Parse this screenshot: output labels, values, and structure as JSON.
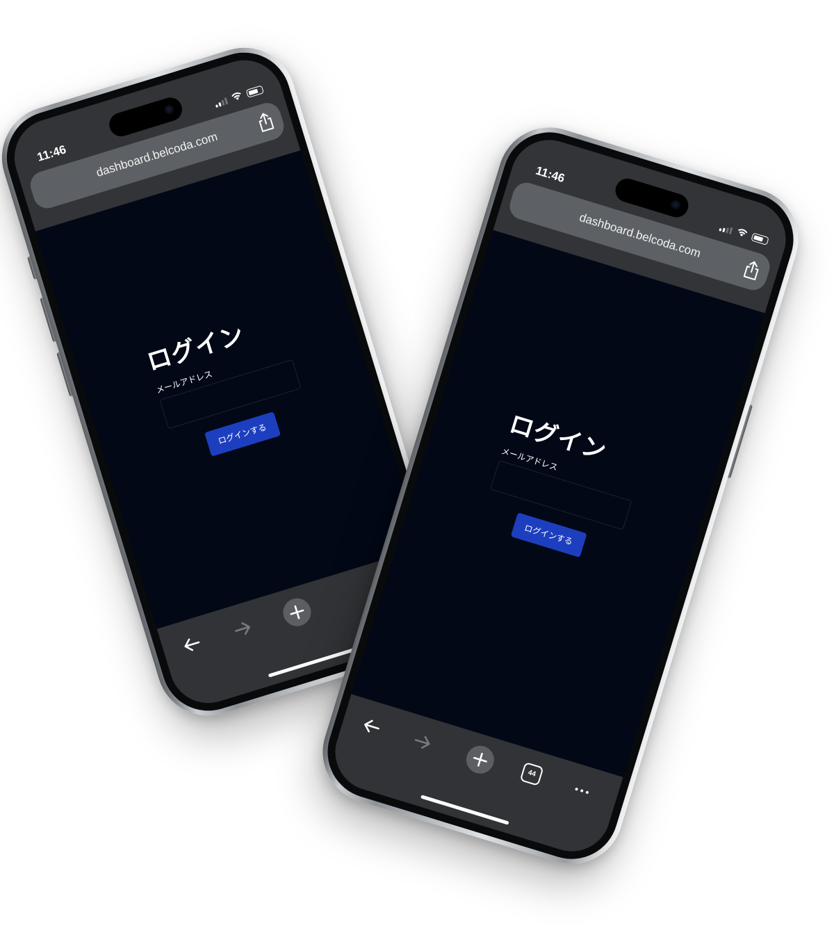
{
  "colors": {
    "page_background": "#020816",
    "browser_chrome": "#323437",
    "url_pill": "#5d6064",
    "primary_button": "#1d3fbf"
  },
  "phones": [
    {
      "status_time": "11:46",
      "url": "dashboard.belcoda.com",
      "login_title": "ログイン",
      "email_label": "メールアドレス",
      "email_value": "",
      "submit_label": "ログインする",
      "tabs_count": "",
      "icons": [
        "signal-icon",
        "wifi-icon",
        "battery-icon",
        "share-icon",
        "back-arrow-icon",
        "forward-arrow-icon",
        "new-tab-plus-icon"
      ]
    },
    {
      "status_time": "11:46",
      "url": "dashboard.belcoda.com",
      "login_title": "ログイン",
      "email_label": "メールアドレス",
      "email_value": "",
      "submit_label": "ログインする",
      "tabs_count": "44",
      "icons": [
        "signal-icon",
        "wifi-icon",
        "battery-icon",
        "share-icon",
        "back-arrow-icon",
        "forward-arrow-icon",
        "new-tab-plus-icon",
        "tabs-icon",
        "more-icon"
      ]
    }
  ]
}
